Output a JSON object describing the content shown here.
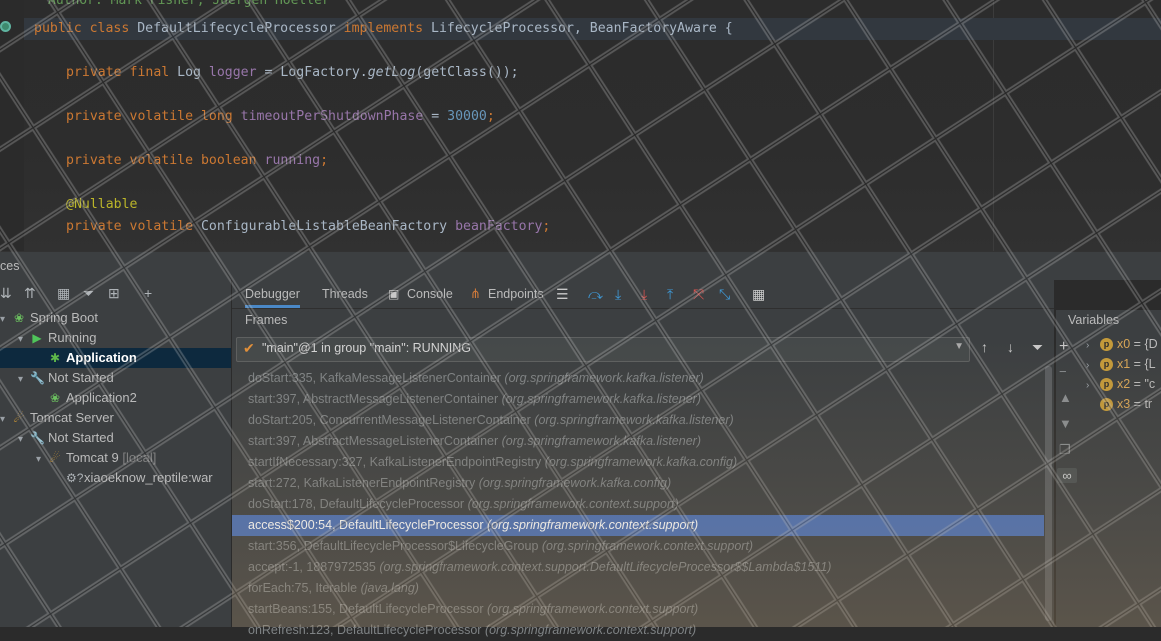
{
  "editor": {
    "comment": "Author: Mark Fisher, Juergen Hoeller",
    "lines": [
      {
        "parts": [
          {
            "t": "public class ",
            "c": "kw"
          },
          {
            "t": "DefaultLifecycleProcessor ",
            "c": ""
          },
          {
            "t": "implements ",
            "c": "kw"
          },
          {
            "t": "LifecycleProcessor, BeanFactoryAware {",
            "c": ""
          }
        ]
      },
      {
        "parts": [
          {
            "t": "private final ",
            "c": "kw"
          },
          {
            "t": "Log ",
            "c": ""
          },
          {
            "t": "logger",
            "c": "fld"
          },
          {
            "t": " = LogFactory.",
            "c": ""
          },
          {
            "t": "getLog",
            "c": "mth"
          },
          {
            "t": "(getClass());",
            "c": ""
          }
        ]
      },
      {
        "parts": [
          {
            "t": "private volatile long ",
            "c": "kw"
          },
          {
            "t": "timeoutPerShutdownPhase",
            "c": "fld"
          },
          {
            "t": " = ",
            "c": ""
          },
          {
            "t": "30000",
            "c": "num"
          },
          {
            "t": ";",
            "c": "kw"
          }
        ]
      },
      {
        "parts": [
          {
            "t": "private volatile boolean ",
            "c": "kw"
          },
          {
            "t": "running",
            "c": "fld"
          },
          {
            "t": ";",
            "c": "kw"
          }
        ]
      },
      {
        "parts": [
          {
            "t": "@Nullable",
            "c": "ann"
          }
        ]
      },
      {
        "parts": [
          {
            "t": "private volatile ",
            "c": "kw"
          },
          {
            "t": "ConfigurableListableBeanFactory ",
            "c": ""
          },
          {
            "t": "beanFactory",
            "c": "fld"
          },
          {
            "t": ";",
            "c": "kw"
          }
        ]
      }
    ]
  },
  "toolwindow": {
    "title": "ces"
  },
  "services": {
    "tree": [
      {
        "label": "Spring Boot",
        "icon": "spring-icon",
        "glyph": "❀",
        "cls": "spring",
        "indent": 0,
        "arrow": "▾"
      },
      {
        "label": "Running",
        "icon": "run-icon",
        "glyph": "▶",
        "cls": "run",
        "indent": 1,
        "arrow": "▾"
      },
      {
        "label": "Application",
        "icon": "debug-bug-icon",
        "glyph": "✱",
        "cls": "bug",
        "indent": 2,
        "arrow": "",
        "selected": true,
        "bold": true
      },
      {
        "label": "Not Started",
        "icon": "wrench-icon",
        "glyph": "🔧",
        "cls": "wrench",
        "indent": 1,
        "arrow": "▾"
      },
      {
        "label": "Application2",
        "icon": "spring-app-icon",
        "glyph": "❀",
        "cls": "spring",
        "indent": 2,
        "arrow": ""
      },
      {
        "label": "Tomcat Server",
        "icon": "tomcat-icon",
        "glyph": "☄",
        "cls": "tomcat",
        "indent": 0,
        "arrow": "▾"
      },
      {
        "label": "Not Started",
        "icon": "wrench-icon",
        "glyph": "🔧",
        "cls": "wrench",
        "indent": 1,
        "arrow": "▾"
      },
      {
        "label": "Tomcat 9",
        "suffix": " [local]",
        "icon": "tomcat-icon",
        "glyph": "☄",
        "cls": "tomcat",
        "indent": 2,
        "arrow": "▾"
      },
      {
        "label": "xiaoeknow_reptile:war",
        "icon": "artifact-icon",
        "glyph": "⚙?",
        "cls": "wrench",
        "indent": 3,
        "arrow": ""
      }
    ]
  },
  "debugger": {
    "tabs": [
      "Debugger",
      "Threads",
      "Console",
      "Endpoints"
    ],
    "frames_title": "Frames",
    "thread": "\"main\"@1 in group \"main\": RUNNING",
    "frames": [
      {
        "m": "doStart:335, KafkaMessageListenerContainer ",
        "p": "(org.springframework.kafka.listener)"
      },
      {
        "m": "start:397, AbstractMessageListenerContainer ",
        "p": "(org.springframework.kafka.listener)"
      },
      {
        "m": "doStart:205, ConcurrentMessageListenerContainer ",
        "p": "(org.springframework.kafka.listener)"
      },
      {
        "m": "start:397, AbstractMessageListenerContainer ",
        "p": "(org.springframework.kafka.listener)"
      },
      {
        "m": "startIfNecessary:327, KafkaListenerEndpointRegistry ",
        "p": "(org.springframework.kafka.config)"
      },
      {
        "m": "start:272, KafkaListenerEndpointRegistry ",
        "p": "(org.springframework.kafka.config)"
      },
      {
        "m": "doStart:178, DefaultLifecycleProcessor ",
        "p": "(org.springframework.context.support)"
      },
      {
        "m": "access$200:54, DefaultLifecycleProcessor ",
        "p": "(org.springframework.context.support)",
        "selected": true
      },
      {
        "m": "start:356, DefaultLifecycleProcessor$LifecycleGroup ",
        "p": "(org.springframework.context.support)"
      },
      {
        "m": "accept:-1, 1887972535 ",
        "p": "(org.springframework.context.support.DefaultLifecycleProcessor$$Lambda$1511)"
      },
      {
        "m": "forEach:75, Iterable ",
        "p": "(java.lang)"
      },
      {
        "m": "startBeans:155, DefaultLifecycleProcessor ",
        "p": "(org.springframework.context.support)"
      },
      {
        "m": "onRefresh:123, DefaultLifecycleProcessor ",
        "p": "(org.springframework.context.support)"
      }
    ]
  },
  "variables": {
    "title": "Variables",
    "items": [
      {
        "name": "x0",
        "value": " = {D",
        "expandable": true
      },
      {
        "name": "x1",
        "value": " = {L",
        "expandable": true
      },
      {
        "name": "x2",
        "value": " = \"c",
        "expandable": true
      },
      {
        "name": "x3",
        "value": " = tr",
        "expandable": false
      }
    ]
  }
}
